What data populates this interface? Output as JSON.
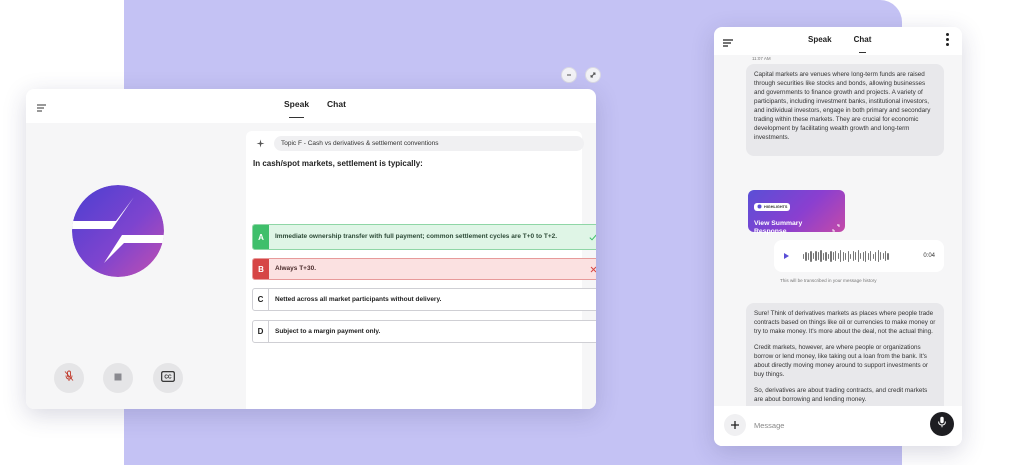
{
  "main_window": {
    "tabs": [
      {
        "label": "Speak",
        "active": true
      },
      {
        "label": "Chat",
        "active": false
      }
    ],
    "topic": "Topic F - Cash vs derivatives & settlement conventions",
    "question": "In cash/spot markets, settlement is typically:",
    "options": [
      {
        "letter": "A",
        "text": "Immediate ownership transfer with full payment; common settlement cycles are T+0 to T+2.",
        "state": "correct"
      },
      {
        "letter": "B",
        "text": "Always T+30.",
        "state": "incorrect"
      },
      {
        "letter": "C",
        "text": "Netted across all market participants without delivery.",
        "state": "neutral"
      },
      {
        "letter": "D",
        "text": "Subject to a margin payment only.",
        "state": "neutral"
      }
    ],
    "controls": [
      {
        "icon": "mic-off-icon"
      },
      {
        "icon": "stop-icon"
      },
      {
        "icon": "closed-captions-icon"
      }
    ],
    "window_controls": [
      {
        "icon": "minimize-icon"
      },
      {
        "icon": "collapse-icon"
      }
    ]
  },
  "chat_window": {
    "tabs": [
      {
        "label": "Speak",
        "active": false
      },
      {
        "label": "Chat",
        "active": true
      }
    ],
    "timestamp": "11:07 AM",
    "message1": "Capital markets are venues where long-term funds are raised through securities like stocks and bonds, allowing businesses and governments to finance growth and projects. A variety of participants, including investment banks, institutional investors, and individual investors, engage in both primary and secondary trading within these markets. They are crucial for economic development by facilitating wealth growth and long-term investments.",
    "highlight": {
      "badge": "HIGHLIGHTS",
      "title": "View Summary Response"
    },
    "audio": {
      "duration": "0:04",
      "note": "This will be transcribed in your message history"
    },
    "message2": [
      "Sure! Think of derivatives markets as places where people trade contracts based on things like oil or currencies to make money or try to make money. It's more about the deal, not the actual thing.",
      "Credit markets, however, are where people or organizations borrow or lend money, like taking out a loan from the bank. It's about directly moving money around to support investments or buy things.",
      "So, derivatives are about trading contracts, and credit markets are about borrowing and lending money."
    ],
    "input": {
      "placeholder": "Message",
      "value": ""
    }
  },
  "colors": {
    "background_panel": "#c4c2f4",
    "correct": "#3fbf6b",
    "incorrect": "#d64545",
    "accent_purple": "#5a4fd6"
  }
}
